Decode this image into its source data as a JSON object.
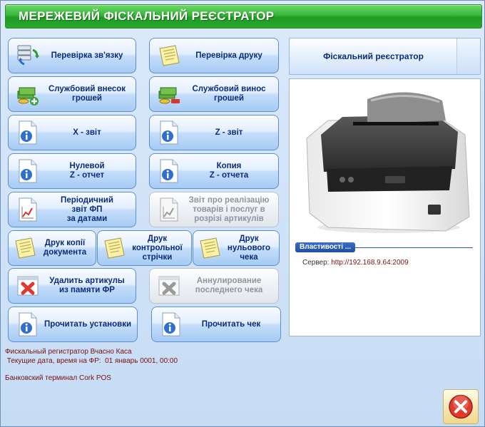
{
  "window": {
    "title": "МЕРЕЖЕВИЙ ФІСКАЛЬНИЙ РЕЄСТРАТОР"
  },
  "buttons": {
    "check_connection": {
      "label": "Перевірка зв'язку",
      "icon": "server-sync-icon"
    },
    "check_print": {
      "label": "Перевірка друку",
      "icon": "notepad-icon"
    },
    "cash_in": {
      "label": "Службовий внесок\nгрошей",
      "icon": "money-add-icon"
    },
    "cash_out": {
      "label": "Службовий винос\nгрошей",
      "icon": "money-remove-icon"
    },
    "x_report": {
      "label": "X - звіт",
      "icon": "info-document-icon"
    },
    "z_report": {
      "label": "Z - звіт",
      "icon": "info-document-icon"
    },
    "zero_report": {
      "label": "Нулевой\nZ - отчет",
      "icon": "info-document-icon"
    },
    "copy_z": {
      "label": "Копия\nZ - отчета",
      "icon": "info-document-icon"
    },
    "periodic_report": {
      "label": "Періодичний\nзвіт ФП\nза датами",
      "icon": "chart-document-icon"
    },
    "sales_report": {
      "label": "Звіт про реалізацію\nтоварів і послуг в\nрозрізі артикулів",
      "icon": "chart-document-icon"
    },
    "print_copy": {
      "label": "Друк копії\nдокумента",
      "icon": "notepad-icon"
    },
    "print_control": {
      "label": "Друк\nконтрольної\nстрічки",
      "icon": "notepad-icon"
    },
    "print_zero": {
      "label": "Друк\nнульового\nчека",
      "icon": "notepad-icon"
    },
    "delete_articles": {
      "label": "Удалить артикулы\nиз памяти ФР",
      "icon": "delete-x-icon"
    },
    "cancel_last": {
      "label": "Аннулирование\nпоследнего чека",
      "icon": "delete-x-icon"
    },
    "read_settings": {
      "label": "Прочитать установки",
      "icon": "info-document-icon"
    },
    "read_check": {
      "label": "Прочитать чек",
      "icon": "info-document-icon"
    }
  },
  "panel": {
    "title": "Фіскальний реєстратор",
    "image": "receipt-printer-image",
    "properties_label": "Властивості ...",
    "server_label": "Сервер:",
    "server_value": "http://192.168.9.64:2009"
  },
  "status": {
    "registrar": "Фискальный регистратор Вчасно Каса",
    "datetime_label": " Текущие дата, время на ФР:",
    "datetime_value": "01 январь 0001, 00:00",
    "terminal": "Банковский терминал Cork POS"
  },
  "close_button": {
    "icon": "close-red-x-icon"
  },
  "colors": {
    "title_green": "#2aa82d",
    "button_text": "#0b2c7a",
    "status_text": "#7a1010",
    "panel_accent": "#1e4fa3"
  }
}
